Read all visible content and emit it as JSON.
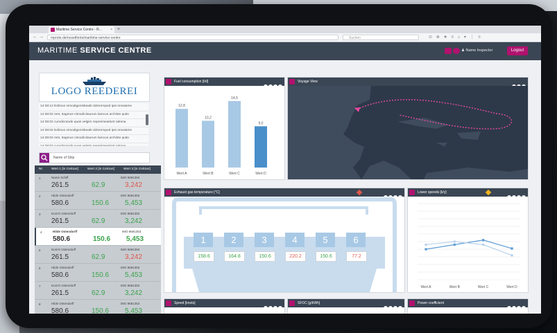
{
  "browser": {
    "tab_title": "Maritime Service Centre - R...",
    "tab_close": "×",
    "new_tab": "+",
    "url": "mprote.de/nosetfonts/maritime-service-centre",
    "search_placeholder": "Suchen",
    "nav_back": "←",
    "nav_forward": "→",
    "tools": "⊙ ⊕ ★ ≡ ⌂ ▾ ⋮ ≡"
  },
  "app": {
    "brand_light": "MARITIME",
    "brand_bold": "SERVICE CENTRE",
    "user_name": "Name Inspector",
    "logout_label": "Logout",
    "accent": "#b0126e",
    "header_bg": "#3b4654"
  },
  "sidebar": {
    "logo_text": "LOGO REEDEREI",
    "messages": [
      "14:38:12 Edimus nimodigenisbeatit doloremped ipsi renwiame",
      "14:38:02 rest, Itagmus nimodicitaurum lamcus archiste quito",
      "14:38:02 cumdicrande quas velgim nepreimeationt rationa",
      "14:38:02 Edimus nimodigenisbeatit doloremped ipsi renwiame",
      "14:38:02 rest, Itagmus nimodicitaurum lamcus archiste quito",
      "14:38:02 cumdicrande quas velgim nepreimeationt rationa"
    ],
    "search_placeholder": "Name of Ship",
    "table_headers": [
      "Nr",
      "Wert 1 [in Celcius]",
      "Wert 2 [in Celcius]",
      "Wert 3 [in Celcius]"
    ],
    "rows": [
      {
        "nr": "1",
        "name": "Name Schiff",
        "imo": "IMO 9681353",
        "v1": "261.5",
        "v2": "62.9",
        "v3": "3,242",
        "v3_color": "#e0574a"
      },
      {
        "nr": "2",
        "name": "Hilde Ostendorff",
        "imo": "IMO 9681353",
        "v1": "580.6",
        "v2": "150.6",
        "v3": "5,453",
        "v3_color": "#3aa34a"
      },
      {
        "nr": "3",
        "name": "Dorich Ostendorff",
        "imo": "IMO 9681353",
        "v1": "261.5",
        "v2": "62.9",
        "v3": "3,242",
        "v3_color": "#3aa34a"
      },
      {
        "nr": "4",
        "name": "Hilde Ostendorff",
        "imo": "IMO 9681353",
        "v1": "580.6",
        "v2": "150.6",
        "v3": "5,453",
        "v3_color": "#3aa34a"
      },
      {
        "nr": "5",
        "name": "Dorich Ostendorff",
        "imo": "IMO 9681353",
        "v1": "261.5",
        "v2": "62.9",
        "v3": "3,242",
        "v3_color": "#e0574a"
      },
      {
        "nr": "6",
        "name": "Hilde Ostendorff",
        "imo": "IMO 9681353",
        "v1": "580.6",
        "v2": "150.6",
        "v3": "5,453",
        "v3_color": "#3aa34a"
      },
      {
        "nr": "7",
        "name": "Dorich Ostendorff",
        "imo": "IMO 9681353",
        "v1": "261.5",
        "v2": "62.9",
        "v3": "3,242",
        "v3_color": "#3aa34a"
      },
      {
        "nr": "8",
        "name": "Hilde Ostendorff",
        "imo": "IMO 9681353",
        "v1": "580.6",
        "v2": "150.6",
        "v3": "5,453",
        "v3_color": "#3aa34a"
      }
    ]
  },
  "panels": {
    "fuel": {
      "title": "Fuel consumption [t/d]"
    },
    "voyage": {
      "title": "Voyage View"
    },
    "exhaust": {
      "title": "Exhaust gas temperature [°C]",
      "cylinders": [
        "1",
        "2",
        "3",
        "4",
        "5",
        "6"
      ],
      "temps": [
        "158.6",
        "164.8",
        "150.6",
        "220.2",
        "150.6",
        "77.2"
      ],
      "temp_colors": [
        "#3aa34a",
        "#3aa34a",
        "#3aa34a",
        "#e0574a",
        "#3aa34a",
        "#e0574a"
      ]
    },
    "lower": {
      "title": "Lower speeds [k/y]"
    },
    "speed": {
      "title": "Speed [knots]"
    },
    "sfoc": {
      "title": "SFOC [g/kWh]"
    },
    "power": {
      "title": "Power coefficient"
    }
  },
  "chart_data": [
    {
      "type": "bar",
      "categories": [
        "Wert A",
        "Wert B",
        "Wert C",
        "Wert D"
      ],
      "values": [
        12.8,
        10.2,
        14.5,
        9.0
      ],
      "labels": [
        "12,8",
        "10,2",
        "14,5",
        "9,0"
      ],
      "ylim": [
        0,
        16
      ]
    },
    {
      "type": "line",
      "categories": [
        "Wert A",
        "Wert B",
        "Wert C",
        "Wert D"
      ],
      "series": [
        {
          "values": [
            4.0,
            4.6,
            5.2,
            4.1
          ],
          "color": "#5b9bd5"
        },
        {
          "values": [
            4.6,
            5.0,
            4.6,
            3.2
          ],
          "color": "#b9d3ec"
        }
      ],
      "ylim": [
        0,
        10
      ],
      "grid": true
    }
  ]
}
